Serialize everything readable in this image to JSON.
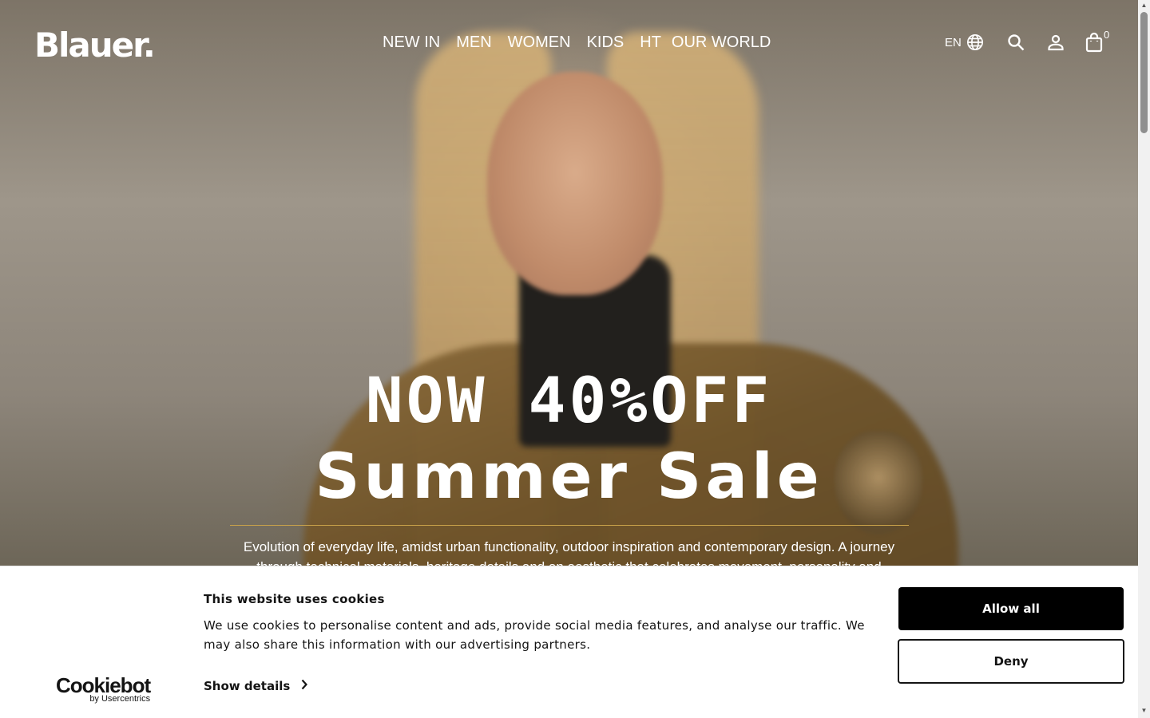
{
  "header": {
    "logo": "Blauer.",
    "nav": [
      "NEW IN",
      "MEN",
      "WOMEN",
      "KIDS",
      "HT",
      "OUR WORLD"
    ],
    "language": "EN",
    "cart_count": "0",
    "icons": [
      "globe-icon",
      "search-icon",
      "account-icon",
      "shopping-bag-icon"
    ]
  },
  "hero": {
    "headline_1": "NOW 40%OFF",
    "headline_2": "Summer Sale",
    "description": "Evolution of everyday life, amidst urban functionality, outdoor inspiration and contemporary design. A journey through technical materials, heritage details and an aesthetic that celebrates movement, personality and"
  },
  "cookie_banner": {
    "title": "This website uses cookies",
    "text": "We use cookies to personalise content and ads, provide social media features, and analyse our traffic. We may also share this information with our advertising partners.",
    "show_details": "Show details",
    "allow_all": "Allow all",
    "deny": "Deny",
    "brand": "Cookiebot",
    "brand_sub": "by Usercentrics"
  },
  "colors": {
    "accent_rule": "#c9a24a",
    "button_dark": "#000000"
  }
}
